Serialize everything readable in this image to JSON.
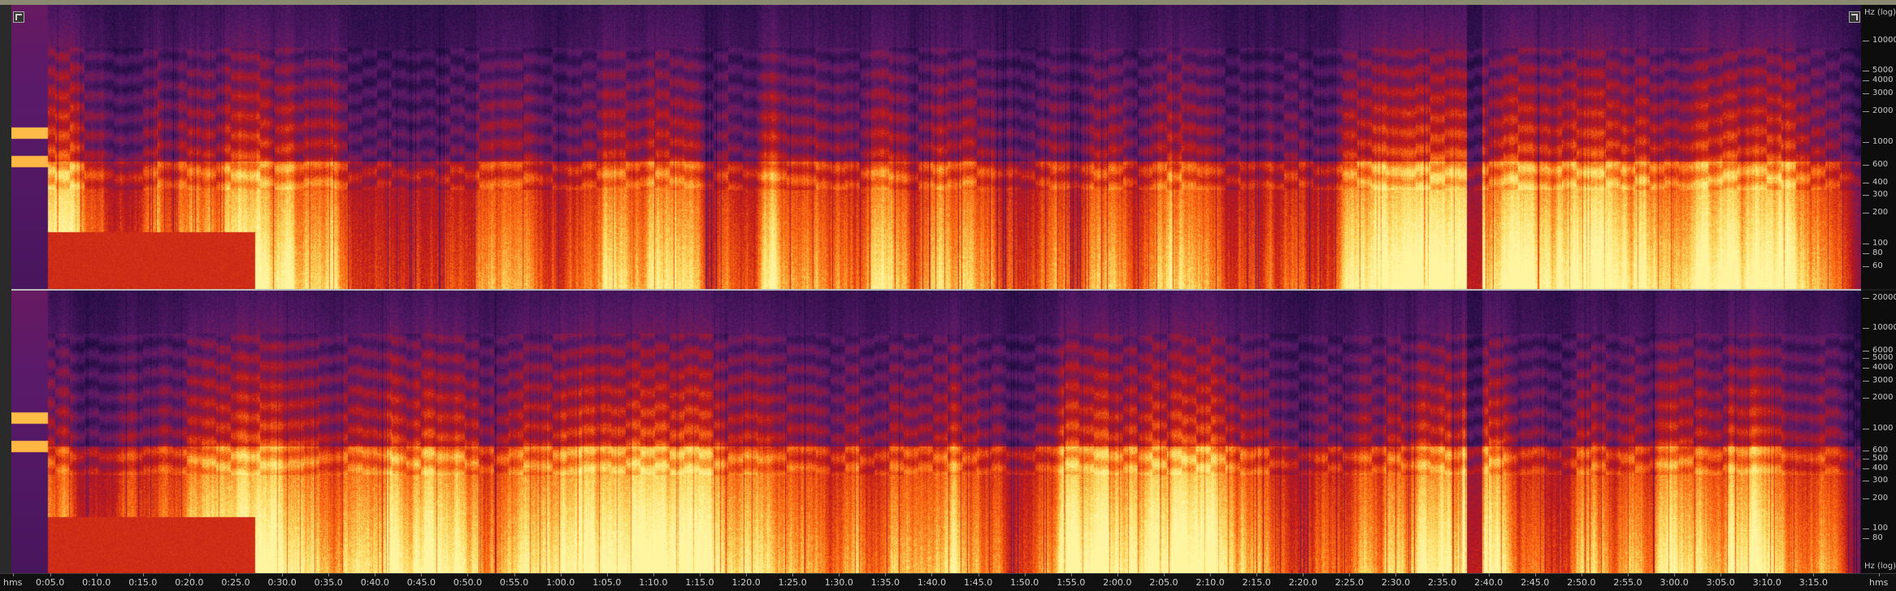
{
  "frequency_scale": {
    "unit_top": "Hz (log)",
    "unit_bottom": "Hz (log)",
    "top_ticks": [
      "10000",
      "5000",
      "4000",
      "3000",
      "2000",
      "1000",
      "600",
      "400",
      "300",
      "200",
      "100",
      "80",
      "60"
    ],
    "bottom_ticks": [
      "20000",
      "10000",
      "6000",
      "5000",
      "4000",
      "3000",
      "2000",
      "1000",
      "600",
      "500",
      "400",
      "300",
      "200",
      "100",
      "80"
    ]
  },
  "timeline": {
    "unit_left": "hms",
    "unit_right": "hms",
    "labels": [
      "0:05.0",
      "0:10.0",
      "0:15.0",
      "0:20.0",
      "0:25.0",
      "0:30.0",
      "0:35.0",
      "0:40.0",
      "0:45.0",
      "0:50.0",
      "0:55.0",
      "1:00.0",
      "1:05.0",
      "1:10.0",
      "1:15.0",
      "1:20.0",
      "1:25.0",
      "1:30.0",
      "1:35.0",
      "1:40.0",
      "1:45.0",
      "1:50.0",
      "1:55.0",
      "2:00.0",
      "2:05.0",
      "2:10.0",
      "2:15.0",
      "2:20.0",
      "2:25.0",
      "2:30.0",
      "2:35.0",
      "2:40.0",
      "2:45.0",
      "2:50.0",
      "2:55.0",
      "3:00.0",
      "3:05.0",
      "3:10.0",
      "3:15.0"
    ]
  },
  "colors": {
    "low": "#1a0a3a",
    "mid_low": "#5a1a6a",
    "mid": "#c01818",
    "mid_high": "#ff6a10",
    "high": "#ffd85a",
    "peak": "#fff4a0"
  }
}
